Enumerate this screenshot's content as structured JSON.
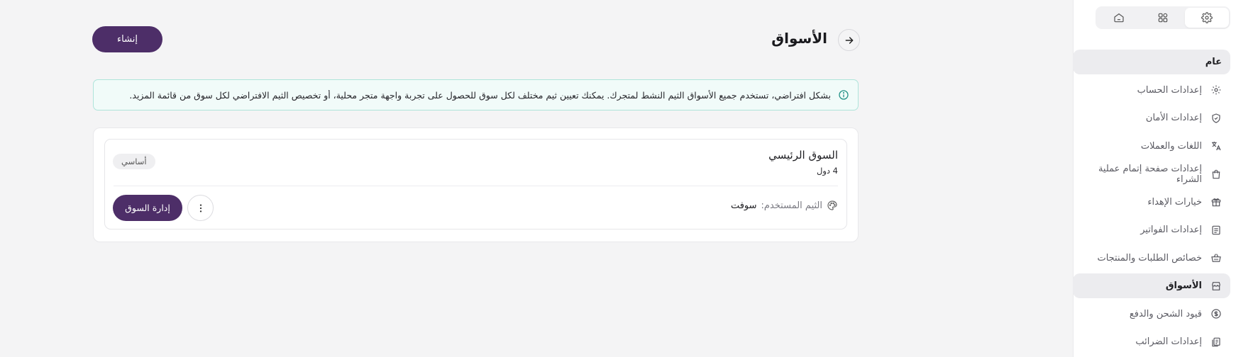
{
  "page": {
    "title": "الأسواق",
    "create_label": "إنشاء"
  },
  "info_banner": {
    "text": "بشكل افتراضي، تستخدم جميع الأسواق الثيم النشط لمتجرك. يمكنك تعيين ثيم مختلف لكل سوق للحصول على تجربة واجهة متجر محلية، أو تخصيص الثيم الافتراضي لكل سوق من قائمة المزيد."
  },
  "market": {
    "name": "السوق الرئيسي",
    "countries": "4 دول",
    "badge": "أساسي",
    "theme_label": "الثيم المستخدم:",
    "theme_value": "سوفت",
    "manage_label": "إدارة السوق"
  },
  "sidebar": {
    "tabs": [
      {
        "icon": "gear-icon",
        "active": true
      },
      {
        "icon": "apps-icon",
        "active": false
      },
      {
        "icon": "home-icon",
        "active": false
      }
    ],
    "group_label": "عام",
    "items": [
      {
        "label": "إعدادات الحساب",
        "icon": "gear-icon"
      },
      {
        "label": "إعدادات الأمان",
        "icon": "shield-icon"
      },
      {
        "label": "اللغات والعملات",
        "icon": "translate-icon"
      },
      {
        "label": "إعدادات صفحة إتمام عملية الشراء",
        "icon": "bag-icon"
      },
      {
        "label": "خيارات الإهداء",
        "icon": "gift-icon"
      },
      {
        "label": "إعدادات الفواتير",
        "icon": "invoice-icon"
      },
      {
        "label": "خصائص الطلبات والمنتجات",
        "icon": "basket-icon"
      },
      {
        "label": "الأسواق",
        "icon": "store-icon",
        "active": true
      },
      {
        "label": "قيود الشحن والدفع",
        "icon": "dollar-circle-icon"
      },
      {
        "label": "إعدادات الضرائب",
        "icon": "tax-icon"
      }
    ]
  },
  "colors": {
    "primary": "#4d2e68",
    "banner_bg": "#f1fbf9",
    "banner_border": "#aee4da",
    "info_icon": "#1f8f84"
  }
}
